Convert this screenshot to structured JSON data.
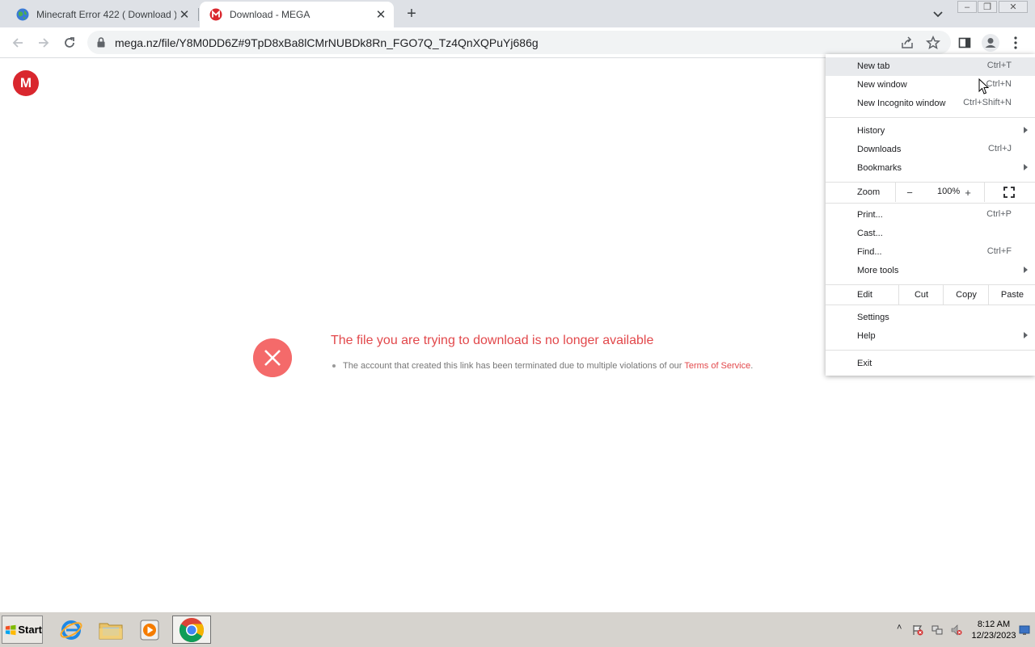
{
  "browser": {
    "tabs": [
      {
        "title": "Minecraft Error 422 ( Download )!",
        "active": false,
        "favicon": "globe-icon"
      },
      {
        "title": "Download - MEGA",
        "active": true,
        "favicon": "mega-icon"
      }
    ],
    "url": "mega.nz/file/Y8M0DD6Z#9TpD8xBa8lCMrNUBDk8Rn_FGO7Q_Tz4QnXQPuYj686g"
  },
  "page": {
    "logo_letter": "M",
    "error_title": "The file you are trying to download is no longer available",
    "error_message": "The account that created this link has been terminated due to multiple violations of our ",
    "tos_link": "Terms of Service",
    "tos_suffix": ".",
    "accent_color": "#e2484b"
  },
  "menu": {
    "new_tab": {
      "label": "New tab",
      "shortcut": "Ctrl+T"
    },
    "new_window": {
      "label": "New window",
      "shortcut": "Ctrl+N"
    },
    "new_incognito": {
      "label": "New Incognito window",
      "shortcut": "Ctrl+Shift+N"
    },
    "history": {
      "label": "History"
    },
    "downloads": {
      "label": "Downloads",
      "shortcut": "Ctrl+J"
    },
    "bookmarks": {
      "label": "Bookmarks"
    },
    "zoom": {
      "label": "Zoom",
      "minus": "−",
      "value": "100%",
      "plus": "+"
    },
    "print": {
      "label": "Print...",
      "shortcut": "Ctrl+P"
    },
    "cast": {
      "label": "Cast..."
    },
    "find": {
      "label": "Find...",
      "shortcut": "Ctrl+F"
    },
    "more_tools": {
      "label": "More tools"
    },
    "edit": {
      "label": "Edit",
      "cut": "Cut",
      "copy": "Copy",
      "paste": "Paste"
    },
    "settings": {
      "label": "Settings"
    },
    "help": {
      "label": "Help"
    },
    "exit": {
      "label": "Exit"
    }
  },
  "taskbar": {
    "start_label": "Start",
    "time": "8:12 AM",
    "date": "12/23/2023"
  }
}
